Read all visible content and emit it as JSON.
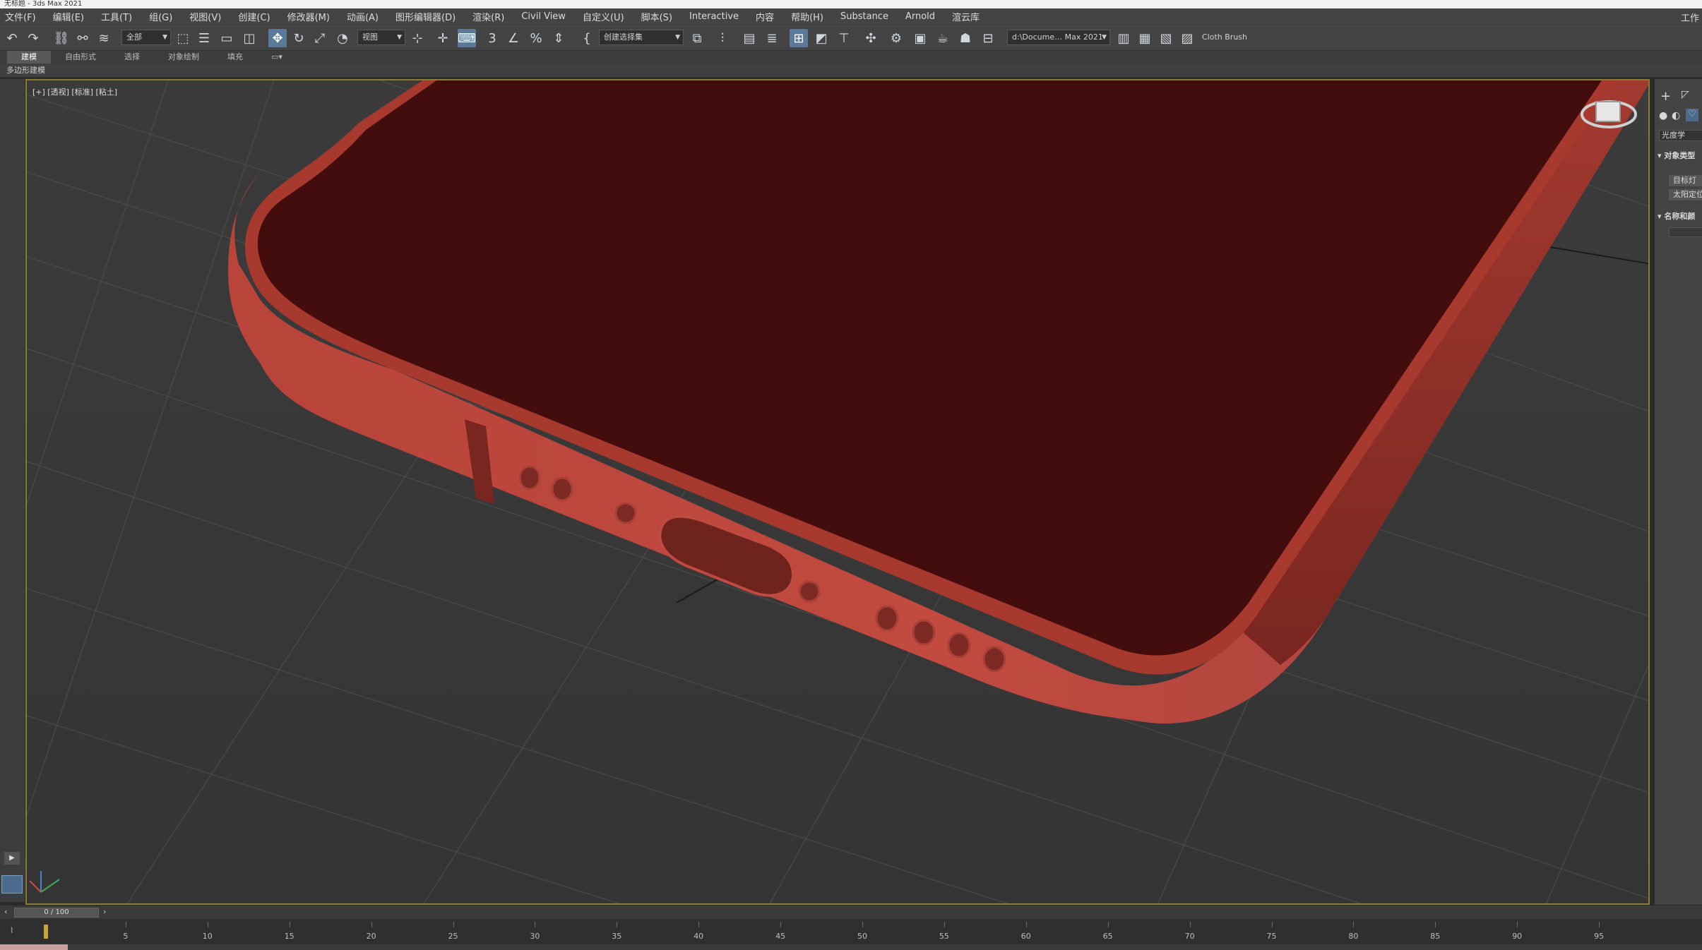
{
  "window": {
    "title": "无标题 - 3ds Max 2021",
    "workspace": "工作"
  },
  "menus": [
    "文件(F)",
    "编辑(E)",
    "工具(T)",
    "组(G)",
    "视图(V)",
    "创建(C)",
    "修改器(M)",
    "动画(A)",
    "图形编辑器(D)",
    "渲染(R)",
    "Civil View",
    "自定义(U)",
    "脚本(S)",
    "Interactive",
    "内容",
    "帮助(H)",
    "Substance",
    "Arnold",
    "渲云库"
  ],
  "toolbar": {
    "filter_value": "全部",
    "coord_value": "视图",
    "selection_set": "创建选择集",
    "project_path": "d:\\Docume… Max 2021",
    "cloth_label": "Cloth Brush"
  },
  "ribbon": {
    "tabs": [
      "建模",
      "自由形式",
      "选择",
      "对象绘制",
      "填充"
    ],
    "active_tab": "建模",
    "panel_label": "多边形建模"
  },
  "viewport": {
    "label": "[+] [透视] [标准] [粘土]",
    "object_color": "#c0463c",
    "screen_color": "#420d0c"
  },
  "command_panel": {
    "category": "光度学",
    "rollout_object_type": "对象类型",
    "btn_target": "目标灯",
    "btn_sun": "太阳定位",
    "rollout_name_color": "名称和颜"
  },
  "timeline": {
    "frame_display": "0 / 100",
    "ticks": [
      "5",
      "10",
      "15",
      "20",
      "25",
      "30",
      "35",
      "40",
      "45",
      "50",
      "55",
      "60",
      "65",
      "70",
      "75",
      "80",
      "85",
      "90",
      "95"
    ]
  }
}
